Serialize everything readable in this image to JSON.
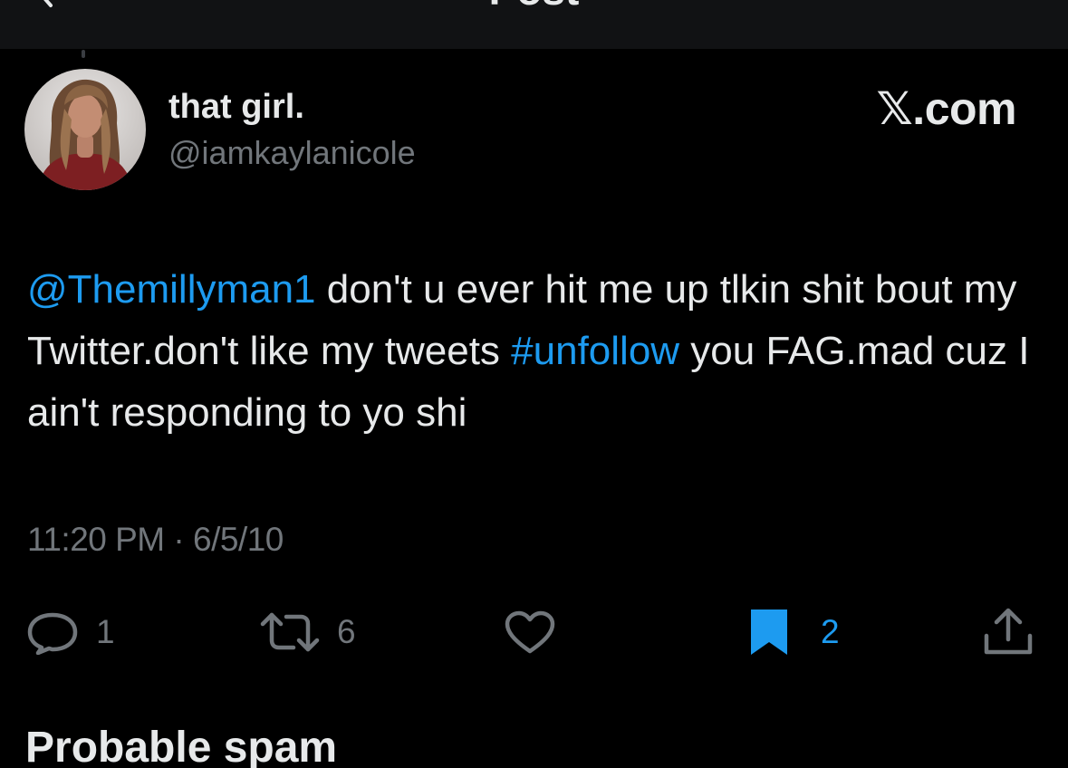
{
  "header": {
    "title": "Post",
    "back_icon": "chevron-left-icon"
  },
  "author": {
    "display_name": "that girl.",
    "handle": "@iamkaylanicole"
  },
  "brand": {
    "mark": "𝕏",
    "text": ".com"
  },
  "tweet": {
    "mention": "@Themillyman1",
    "text_part1": " don't u ever hit me up tlkin shit bout my Twitter.don't like my tweets ",
    "hashtag": "#unfollow",
    "text_part2": " you FAG.mad cuz I ain't responding to yo shi"
  },
  "meta": {
    "timestamp": "11:20 PM · 6/5/10"
  },
  "actions": {
    "reply": {
      "icon": "reply-icon",
      "count": "1"
    },
    "retweet": {
      "icon": "retweet-icon",
      "count": "6"
    },
    "like": {
      "icon": "heart-icon",
      "count": ""
    },
    "bookmark": {
      "icon": "bookmark-icon",
      "count": "2",
      "active": true
    },
    "share": {
      "icon": "share-icon",
      "count": ""
    }
  },
  "section": {
    "title": "Probable spam"
  },
  "colors": {
    "background": "#000000",
    "text": "#e7e9ea",
    "muted": "#71767b",
    "accent": "#1d9bf0"
  }
}
